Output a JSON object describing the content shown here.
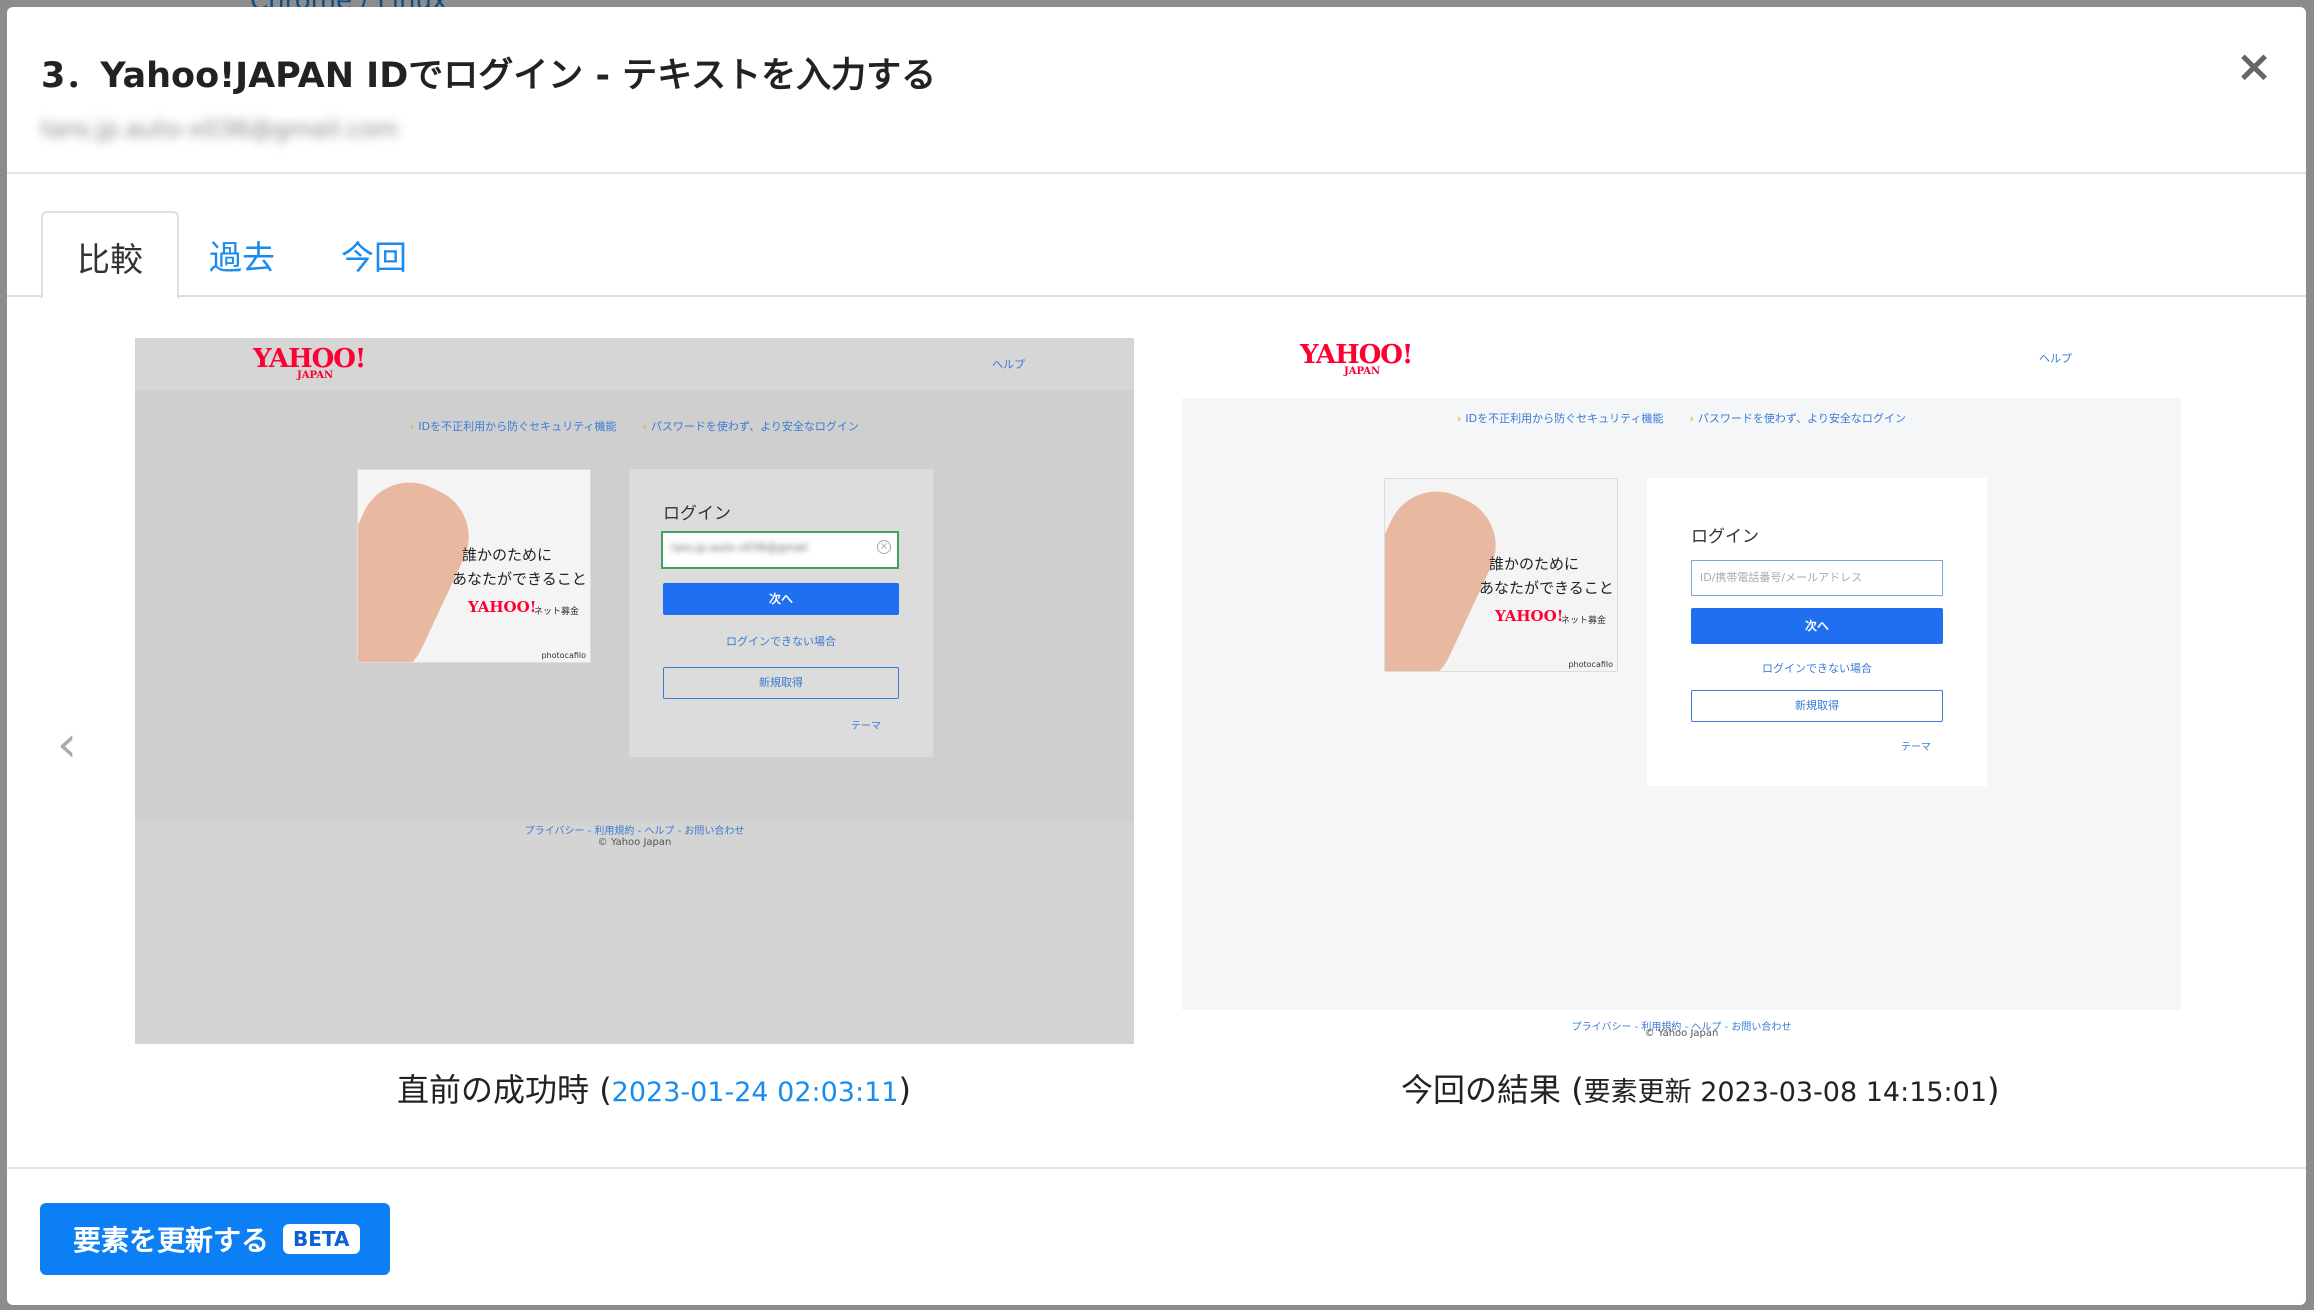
{
  "background": {
    "texts": [
      "Chrome / Linux"
    ]
  },
  "modal": {
    "title": "3．Yahoo!JAPAN IDでログイン - テキストを入力する",
    "subtitle": "taro.jp.auto-x036@gmail.com",
    "close_icon": "close-icon"
  },
  "tabs": [
    {
      "label": "比較",
      "active": true
    },
    {
      "label": "過去",
      "active": false
    },
    {
      "label": "今回",
      "active": false
    }
  ],
  "nav": {
    "prev_icon": "chevron-left-icon",
    "prev_glyph": "‹"
  },
  "past": {
    "caption_label": "直前の成功時",
    "caption_open": " (",
    "caption_time": "2023-01-24 02:03:11",
    "caption_close": ")"
  },
  "current": {
    "caption_label": "今回の結果",
    "caption_open": " (",
    "caption_detail": "要素更新 2023-03-08 14:15:01",
    "caption_close": ")"
  },
  "mini_page": {
    "logo": "YAHOO!",
    "logo_sub": "JAPAN",
    "help": "ヘルプ",
    "links": [
      "IDを不正利用から防ぐセキュリティ機能",
      "パスワードを使わず、より安全なログイン"
    ],
    "promo_line1": "誰かのために",
    "promo_line2": "あなたができること",
    "promo_logo": "YAHOO!",
    "promo_tag": "ネット募金",
    "promo_credit": "photocafilo",
    "login_title": "ログイン",
    "input_placeholder": "ID/携帯電話番号/メールアドレス",
    "input_value_past": "taro.jp.auto-x036@gmail",
    "next_button": "次へ",
    "cant_login": "ログインできない場合",
    "new_account": "新規取得",
    "theme": "テーマ",
    "footer_links": "プライバシー - 利用規約 - ヘルプ - お問い合わせ",
    "copyright": "© Yahoo Japan"
  },
  "footer": {
    "update_button": "要素を更新する",
    "beta_badge": "BETA"
  },
  "colors": {
    "accent": "#0d7ff5",
    "link": "#1a8cf0",
    "yahoo_red": "#ff0033"
  }
}
